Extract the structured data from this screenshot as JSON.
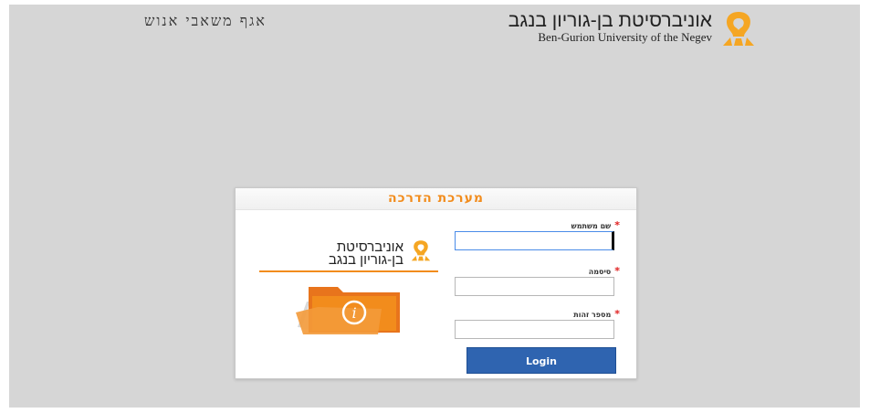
{
  "header": {
    "department_title": "אגף משאבי אנוש",
    "university_name_he": "אוניברסיטת בן-גוריון בנגב",
    "university_name_en": "Ben-Gurion University of the Negev"
  },
  "panel": {
    "title": "מערכת הדרכה",
    "brand_name_line1": "אוניברסיטת",
    "brand_name_line2": "בן-גוריון בנגב",
    "fields": {
      "username_label": "שם משתמש",
      "username_value": "",
      "password_label": "סיסמה",
      "password_value": "",
      "id_label": "מספר זהות",
      "id_value": ""
    },
    "required_marker": "*",
    "login_label": "Login"
  },
  "colors": {
    "accent": "#f28c1c",
    "button": "#2f64b0",
    "background": "#d6d6d6"
  },
  "icons": [
    "bgu-logo-icon",
    "info-folder-icon"
  ]
}
